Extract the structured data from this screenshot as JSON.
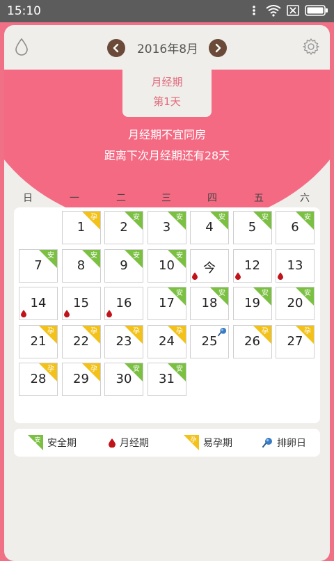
{
  "status_bar": {
    "time": "15:10"
  },
  "header": {
    "month_title": "2016年8月"
  },
  "info": {
    "phase": "月经期",
    "day_label": "第1天",
    "advice": "月经期不宜同房",
    "countdown": "距离下次月经期还有28天"
  },
  "weekdays": [
    "日",
    "一",
    "二",
    "三",
    "四",
    "五",
    "六"
  ],
  "colors": {
    "pink": "#f46a83",
    "safe_green": "#7bc043",
    "fertile_yellow": "#f2c21b",
    "blood_red": "#c0141b",
    "arrow_brown": "#6b4a3a",
    "ovulation_blue": "#3a7cc3"
  },
  "calendar": {
    "days": [
      {
        "label": "1",
        "tag": "fertile",
        "tag_text": "孕"
      },
      {
        "label": "2",
        "tag": "safe",
        "tag_text": "安"
      },
      {
        "label": "3",
        "tag": "safe",
        "tag_text": "安"
      },
      {
        "label": "4",
        "tag": "safe",
        "tag_text": "安"
      },
      {
        "label": "5",
        "tag": "safe",
        "tag_text": "安"
      },
      {
        "label": "6",
        "tag": "safe",
        "tag_text": "安"
      },
      {
        "label": "7",
        "tag": "safe",
        "tag_text": "安"
      },
      {
        "label": "8",
        "tag": "safe",
        "tag_text": "安"
      },
      {
        "label": "9",
        "tag": "safe",
        "tag_text": "安"
      },
      {
        "label": "10",
        "tag": "safe",
        "tag_text": "安"
      },
      {
        "label": "今",
        "menses": true
      },
      {
        "label": "12",
        "menses": true
      },
      {
        "label": "13",
        "menses": true
      },
      {
        "label": "14",
        "menses": true
      },
      {
        "label": "15",
        "menses": true
      },
      {
        "label": "16",
        "menses": true
      },
      {
        "label": "17",
        "tag": "safe",
        "tag_text": "安"
      },
      {
        "label": "18",
        "tag": "safe",
        "tag_text": "安"
      },
      {
        "label": "19",
        "tag": "safe",
        "tag_text": "安"
      },
      {
        "label": "20",
        "tag": "safe",
        "tag_text": "安"
      },
      {
        "label": "21",
        "tag": "fertile",
        "tag_text": "孕"
      },
      {
        "label": "22",
        "tag": "fertile",
        "tag_text": "孕"
      },
      {
        "label": "23",
        "tag": "fertile",
        "tag_text": "孕"
      },
      {
        "label": "24",
        "tag": "fertile",
        "tag_text": "孕"
      },
      {
        "label": "25",
        "ovulation": true
      },
      {
        "label": "26",
        "tag": "fertile",
        "tag_text": "孕"
      },
      {
        "label": "27",
        "tag": "fertile",
        "tag_text": "孕"
      },
      {
        "label": "28",
        "tag": "fertile",
        "tag_text": "孕"
      },
      {
        "label": "29",
        "tag": "fertile",
        "tag_text": "孕"
      },
      {
        "label": "30",
        "tag": "safe",
        "tag_text": "安"
      },
      {
        "label": "31",
        "tag": "safe",
        "tag_text": "安"
      }
    ]
  },
  "legend": [
    {
      "kind": "safe",
      "mark": "安",
      "label": "安全期"
    },
    {
      "kind": "menses",
      "label": "月经期"
    },
    {
      "kind": "fertile",
      "mark": "孕",
      "label": "易孕期"
    },
    {
      "kind": "ovulation",
      "label": "排卵日"
    }
  ]
}
